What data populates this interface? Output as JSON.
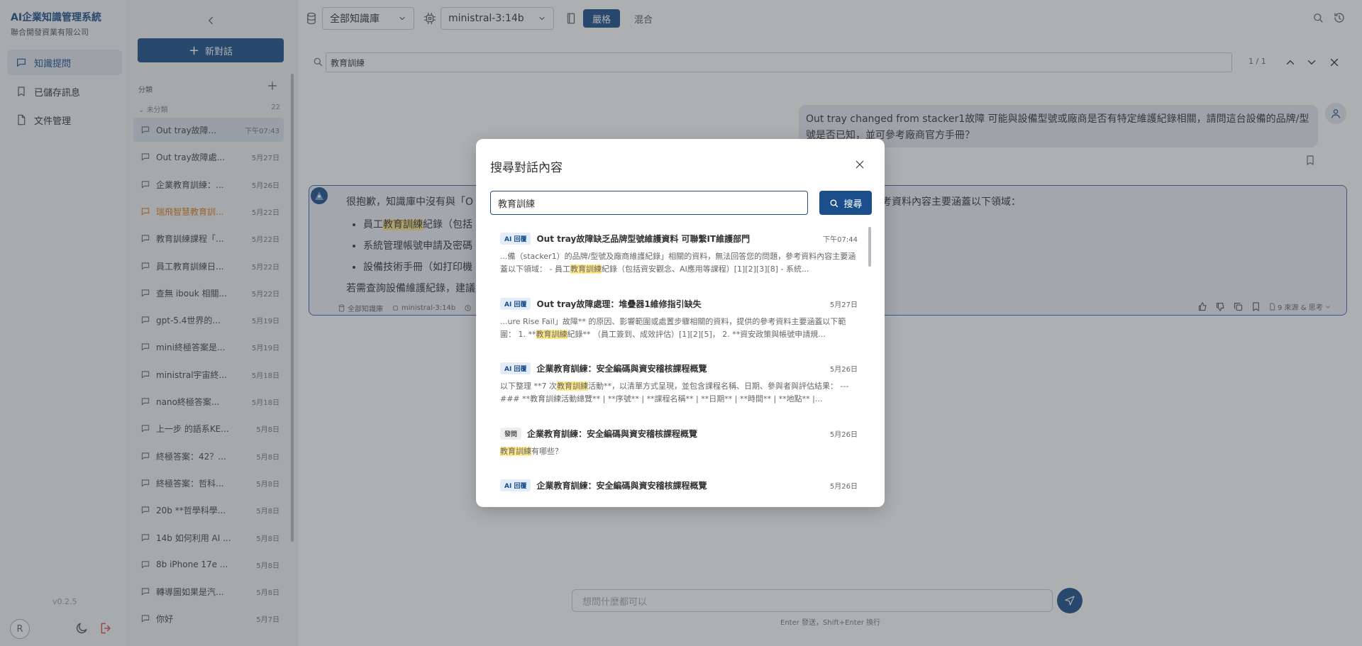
{
  "app": {
    "title": "AI企業知識管理系統",
    "subtitle": "聯合開發資業有限公司",
    "version": "v0.2.5",
    "user_initial": "R"
  },
  "nav": [
    {
      "label": "知識提問",
      "icon": "chat-bubble-icon",
      "active": true
    },
    {
      "label": "已儲存訊息",
      "icon": "bookmark-icon",
      "active": false
    },
    {
      "label": "文件管理",
      "icon": "document-icon",
      "active": false
    }
  ],
  "sidebar": {
    "new_chat_label": "新對話",
    "category_label": "分類",
    "group": {
      "label": "未分類",
      "count": "22"
    },
    "conversations": [
      {
        "title": "Out tray故障...",
        "date": "下午07:43",
        "active": true
      },
      {
        "title": "Out tray故障處...",
        "date": "5月27日"
      },
      {
        "title": "企業教育訓練：...",
        "date": "5月26日"
      },
      {
        "title": "瑞飛智慧教育訓...",
        "date": "5月22日",
        "warn": true
      },
      {
        "title": "教育訓練課程「...",
        "date": "5月22日"
      },
      {
        "title": "員工教育訓練日...",
        "date": "5月22日"
      },
      {
        "title": "查無 ibouk 相關...",
        "date": "5月22日"
      },
      {
        "title": "gpt-5.4世界的...",
        "date": "5月19日"
      },
      {
        "title": "mini終極答案是...",
        "date": "5月19日"
      },
      {
        "title": "ministral宇宙終...",
        "date": "5月18日"
      },
      {
        "title": "nano終極答案...",
        "date": "5月18日"
      },
      {
        "title": "上一步 的語系KE...",
        "date": "5月8日"
      },
      {
        "title": "終極答案：42？...",
        "date": "5月8日"
      },
      {
        "title": "終極答案：哲科...",
        "date": "5月8日"
      },
      {
        "title": "20b **哲學科學...",
        "date": "5月8日"
      },
      {
        "title": "14b 如何利用 AI ...",
        "date": "5月8日"
      },
      {
        "title": "8b iPhone 17e ...",
        "date": "5月8日"
      },
      {
        "title": "轉導圖如果是汽...",
        "date": "5月8日"
      },
      {
        "title": "你好",
        "date": "5月7日"
      }
    ]
  },
  "toolbar": {
    "knowledge_base": "全部知識庫",
    "model": "ministral-3:14b",
    "mode_strict": "嚴格",
    "mode_mixed": "混合"
  },
  "findbar": {
    "query": "教育訓練",
    "count": "1 / 1"
  },
  "chat": {
    "user_message": "Out tray changed from stacker1故障 可能與設備型號或廠商是否有特定維護紀錄相關，請問這台設備的品牌/型號是否已知，並可參考廠商官方手冊？",
    "ai_intro": "很抱歉，知識庫中沒有與「O",
    "ai_intro_right": "考資料內容主要涵蓋以下領域：",
    "ai_bullets": [
      {
        "pre": "員工",
        "hl": "教育訓練",
        "post": "紀錄（包括"
      },
      {
        "pre": "系統管理帳號申請及密碼",
        "hl": "",
        "post": ""
      },
      {
        "pre": "設備技術手冊（如打印機",
        "hl": "",
        "post": ""
      }
    ],
    "ai_outro": "若需查詢設備維護紀錄，建議",
    "ai_meta": {
      "kb": "全部知識庫",
      "model": "ministral-3:14b"
    },
    "sources": "9 來源 & 思考",
    "input_placeholder": "想問什麼都可以",
    "input_hint": "Enter 發送，Shift+Enter 換行"
  },
  "search_modal": {
    "title": "搜尋對話內容",
    "query": "教育訓練",
    "button": "搜尋",
    "results": [
      {
        "badge": "AI 回覆",
        "type": "ai",
        "title": "Out tray故障缺乏品牌型號維護資料 可聯繫IT維護部門",
        "date": "下午07:44",
        "snippet": [
          "...備（stacker1）的品牌/型號及廠商維護紀錄」相關的資料，無法回答您的問題，參考資料內容主要涵蓋以下領域： - 員工",
          "教育訓練",
          "紀錄（包括資安觀念、AI應用等課程）[1][2][3][8] - 系統..."
        ]
      },
      {
        "badge": "AI 回覆",
        "type": "ai",
        "title": "Out tray故障處理：堆疊器1維修指引缺失",
        "date": "5月27日",
        "snippet": [
          "...ure Rise Fail」故障** 的原因、影響範圍或處置步驟相關的資料，提供的參考資料主要涵蓋以下範圍： 1. **",
          "教育訓練",
          "紀錄** （員工簽到、成效評估）[1][2][5]， 2. **資安政策與帳號申請規..."
        ]
      },
      {
        "badge": "AI 回覆",
        "type": "ai",
        "title": "企業教育訓練：安全編碼與資安稽核課程概覽",
        "date": "5月26日",
        "snippet": [
          "以下整理 **7 次",
          "教育訓練",
          "活動**，以清單方式呈現，並包含課程名稱、日期、參與者與評估結果： --- ### **教育訓練活動總覽** | **序號** | **課程名稱** | **日期** | **時間** | **地點** |..."
        ]
      },
      {
        "badge": "發問",
        "type": "q",
        "title": "企業教育訓練：安全編碼與資安稽核課程概覽",
        "date": "5月26日",
        "snippet": [
          "",
          "教育訓練",
          "有哪些？"
        ]
      },
      {
        "badge": "AI 回覆",
        "type": "ai",
        "title": "企業教育訓練：安全編碼與資安稽核課程概覽",
        "date": "5月26日",
        "snippet": [
          "",
          "",
          ""
        ]
      }
    ]
  }
}
